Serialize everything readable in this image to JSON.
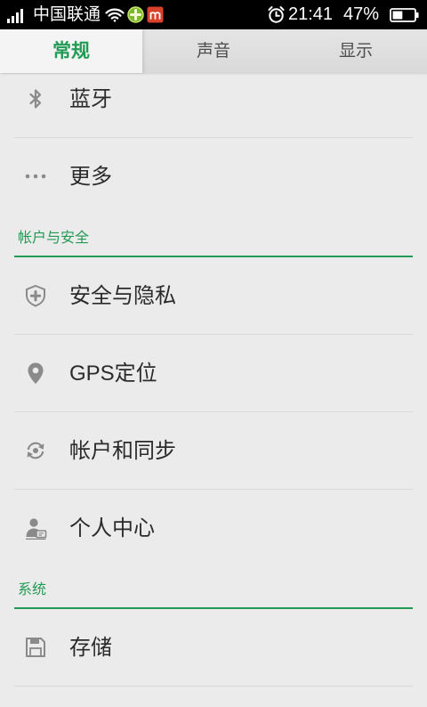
{
  "status_bar": {
    "carrier": "中国联通",
    "time": "21:41",
    "battery_text": "47%",
    "battery_level": 0.47,
    "icons": {
      "signal": "signal-bars-icon",
      "wifi": "wifi-icon",
      "app1": "green-plus-app-icon",
      "app2": "red-m-app-icon",
      "alarm": "alarm-clock-icon",
      "battery": "battery-icon"
    }
  },
  "tabs": [
    {
      "label": "常规",
      "selected": true
    },
    {
      "label": "声音",
      "selected": false
    },
    {
      "label": "显示",
      "selected": false
    }
  ],
  "list": {
    "top_items": [
      {
        "label": "蓝牙",
        "icon": "bluetooth-icon"
      },
      {
        "label": "更多",
        "icon": "more-dots-icon"
      }
    ],
    "sections": [
      {
        "title": "帐户与安全",
        "items": [
          {
            "label": "安全与隐私",
            "icon": "shield-plus-icon"
          },
          {
            "label": "GPS定位",
            "icon": "location-pin-icon"
          },
          {
            "label": "帐户和同步",
            "icon": "sync-icon"
          },
          {
            "label": "个人中心",
            "icon": "person-card-icon"
          }
        ]
      },
      {
        "title": "系统",
        "items": [
          {
            "label": "存储",
            "icon": "floppy-disk-icon"
          }
        ]
      }
    ]
  },
  "colors": {
    "accent": "#219b55",
    "status_bar_bg": "#000000",
    "list_bg": "#ebebeb",
    "icon_gray": "#8a8a8a",
    "text": "#2b2b2b"
  }
}
